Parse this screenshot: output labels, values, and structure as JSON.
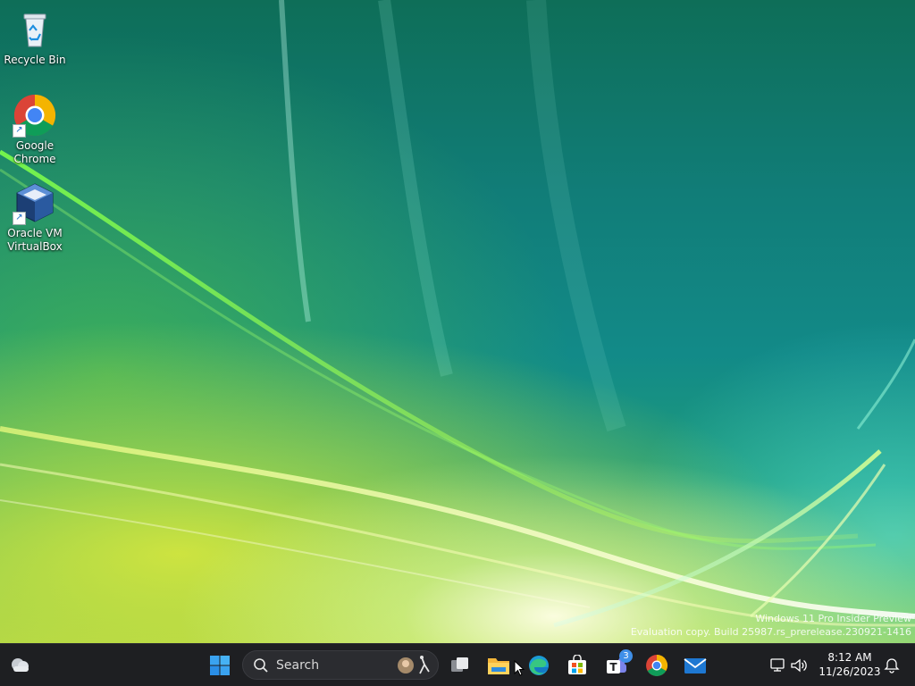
{
  "desktop": {
    "icons": [
      {
        "label": "Recycle Bin",
        "icon": "recycle-bin-icon"
      },
      {
        "label": "Google\nChrome",
        "icon": "chrome-icon"
      },
      {
        "label": "Oracle VM\nVirtualBox",
        "icon": "virtualbox-icon"
      }
    ],
    "watermark": {
      "line1": "Windows 11 Pro Insider Preview",
      "line2": "Evaluation copy. Build 25987.rs_prerelease.230921-1416"
    }
  },
  "taskbar": {
    "search_label": "Search",
    "apps": [
      {
        "name": "task-view",
        "icon": "task-view-icon"
      },
      {
        "name": "file-explorer",
        "icon": "folder-icon"
      },
      {
        "name": "edge",
        "icon": "edge-icon"
      },
      {
        "name": "store",
        "icon": "store-icon"
      },
      {
        "name": "teams",
        "icon": "teams-icon",
        "badge": "3"
      },
      {
        "name": "chrome",
        "icon": "chrome-icon"
      },
      {
        "name": "mail",
        "icon": "mail-icon"
      }
    ],
    "tray": {
      "time": "8:12 AM",
      "date": "11/26/2023"
    }
  },
  "colors": {
    "taskbar_bg": "#1e1f22",
    "accent": "#0078d4"
  }
}
